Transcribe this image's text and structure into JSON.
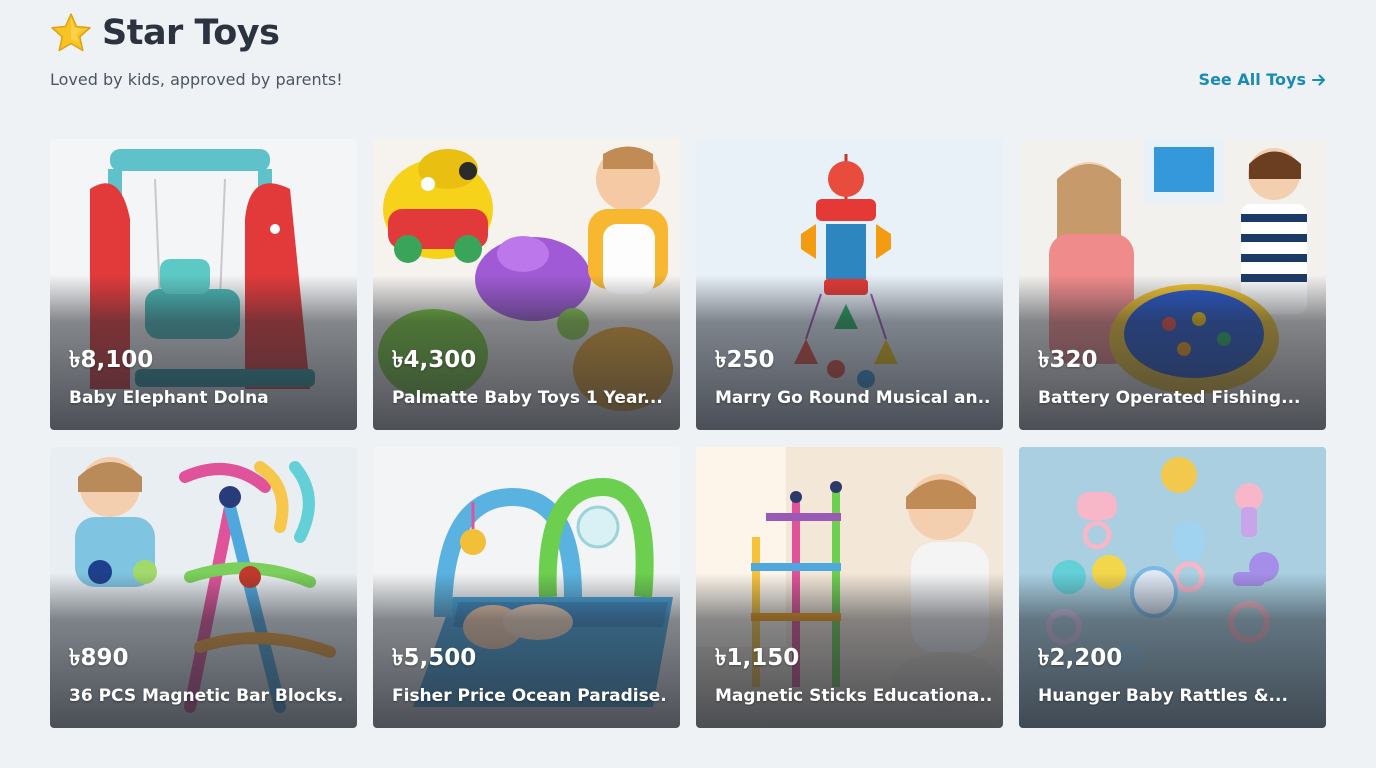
{
  "section": {
    "title": "Star Toys",
    "title_icon": "star-icon",
    "subtitle": "Loved by kids, approved by parents!",
    "see_all_label": "See All Toys",
    "see_all_icon": "arrow-right-icon",
    "accent_color": "#1a8ab8"
  },
  "products": [
    {
      "price": "৳8,100",
      "name": "Baby Elephant Dolna",
      "art": "swing",
      "bg": "#f4f5f6"
    },
    {
      "price": "৳4,300",
      "name": "Palmatte Baby Toys 1 Year...",
      "art": "animals",
      "bg": "#f6f3ef"
    },
    {
      "price": "৳250",
      "name": "Marry Go Round Musical an...",
      "art": "mobile",
      "bg": "#e8f0f8"
    },
    {
      "price": "৳320",
      "name": "Battery Operated Fishing...",
      "art": "fishing",
      "bg": "#f3f1ee"
    },
    {
      "price": "৳890",
      "name": "36 PCS Magnetic Bar Blocks...",
      "art": "blocks",
      "bg": "#e9eef2"
    },
    {
      "price": "৳5,500",
      "name": "Fisher Price Ocean Paradise...",
      "art": "playmat",
      "bg": "#f2f4f5"
    },
    {
      "price": "৳1,150",
      "name": "Magnetic Sticks Educationa...",
      "art": "sticks",
      "bg": "#f3e7d8"
    },
    {
      "price": "৳2,200",
      "name": "Huanger Baby Rattles &...",
      "art": "rattles",
      "bg": "#a9cfe0"
    }
  ]
}
